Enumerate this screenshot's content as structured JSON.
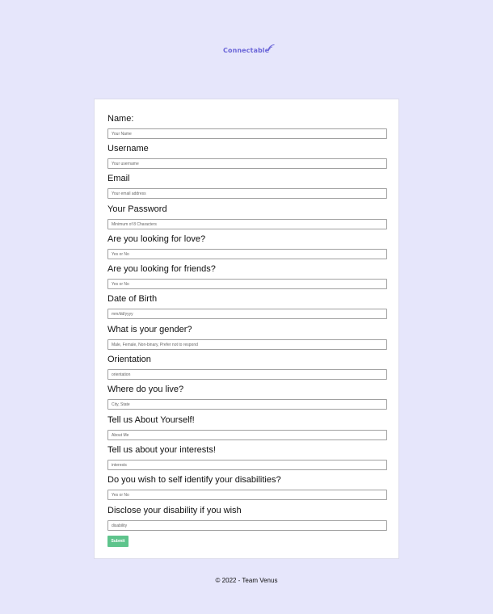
{
  "header": {
    "logo_text": "Connectable"
  },
  "form": {
    "fields": [
      {
        "label": "Name:",
        "placeholder": "Your Name"
      },
      {
        "label": "Username",
        "placeholder": "Your username"
      },
      {
        "label": "Email",
        "placeholder": "Your email address"
      },
      {
        "label": "Your Password",
        "placeholder": "Minimum of 8 Characters"
      },
      {
        "label": "Are you looking for love?",
        "placeholder": "Yes or No"
      },
      {
        "label": "Are you looking for friends?",
        "placeholder": "Yes or No"
      },
      {
        "label": "Date of Birth",
        "placeholder": "mm/dd/yyyy"
      },
      {
        "label": "What is your gender?",
        "placeholder": "Male, Female, Non-binary, Prefer not to respond"
      },
      {
        "label": "Orientation",
        "placeholder": "orientation"
      },
      {
        "label": "Where do you live?",
        "placeholder": "City, State"
      },
      {
        "label": "Tell us About Yourself!",
        "placeholder": "About Me"
      },
      {
        "label": "Tell us about your interests!",
        "placeholder": "interests"
      },
      {
        "label": "Do you wish to self identify your disabilities?",
        "placeholder": "Yes or No"
      },
      {
        "label": "Disclose your disability if you wish",
        "placeholder": "disability"
      }
    ],
    "submit_label": "Submit"
  },
  "footer": {
    "text": "© 2022 - Team Venus"
  },
  "colors": {
    "background": "#e6e6fb",
    "logo": "#6b66d8",
    "submit": "#5ec48c"
  },
  "icons": {
    "logo": "signal-waves-icon"
  }
}
